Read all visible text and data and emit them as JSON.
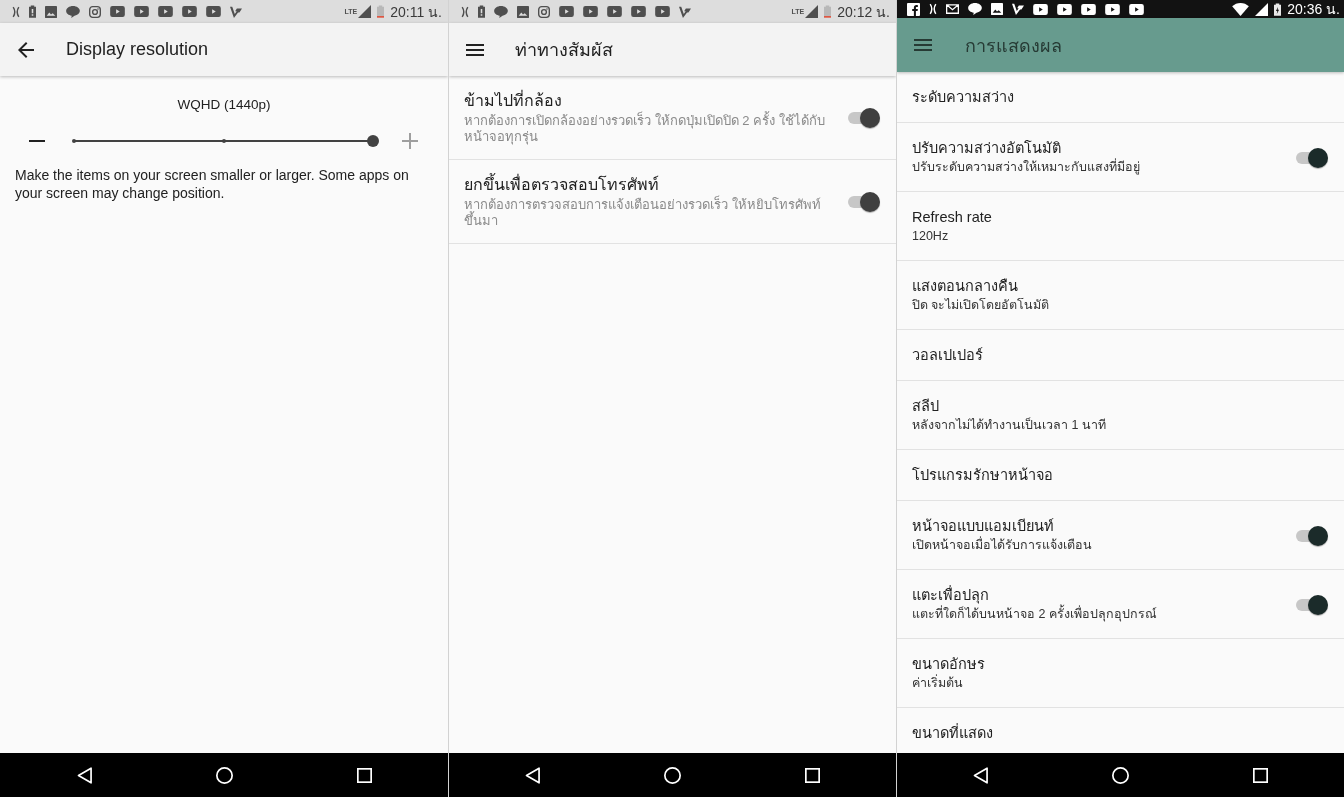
{
  "panels": [
    {
      "kind": "slider",
      "status_bar": {
        "network": "LTE",
        "time": "20:11 น."
      },
      "app_bar": {
        "kind": "back",
        "title": "Display resolution"
      },
      "resolution": {
        "label": "WQHD (1440p)",
        "level": 1
      },
      "description": "Make the items on your screen smaller or larger. Some apps on your screen may change position."
    },
    {
      "kind": "list",
      "status_bar": {
        "network": "LTE",
        "time": "20:12 น."
      },
      "app_bar": {
        "kind": "menu",
        "title": "ท่าทางสัมผัส"
      },
      "settings": [
        {
          "kind": "toggle",
          "title": "ข้ามไปที่กล้อง",
          "summary": "หากต้องการเปิดกล้องอย่างรวดเร็ว ให้กดปุ่มเปิดปิด 2 ครั้ง ใช้ได้กับหน้าจอทุกรุ่น",
          "on": true
        },
        {
          "kind": "toggle",
          "title": "ยกขึ้นเพื่อตรวจสอบโทรศัพท์",
          "summary": "หากต้องการตรวจสอบการแจ้งเตือนอย่างรวดเร็ว ให้หยิบโทรศัพท์ขึ้นมา",
          "on": true
        }
      ]
    },
    {
      "kind": "list",
      "status_bar": {
        "time": "20:36 น."
      },
      "app_bar": {
        "kind": "menu",
        "title": "การแสดงผล"
      },
      "settings": [
        {
          "kind": "text",
          "title": "ระดับความสว่าง"
        },
        {
          "kind": "toggle",
          "title": "ปรับความสว่างอัตโนมัติ",
          "summary": "ปรับระดับความสว่างให้เหมาะกับแสงที่มีอยู่",
          "on": true
        },
        {
          "kind": "text",
          "title": "Refresh rate",
          "summary": "120Hz"
        },
        {
          "kind": "text",
          "title": "แสงตอนกลางคืน",
          "summary": "ปิด จะไม่เปิดโดยอัตโนมัติ"
        },
        {
          "kind": "text",
          "title": "วอลเปเปอร์"
        },
        {
          "kind": "text",
          "title": "สลีป",
          "summary": "หลังจากไม่ได้ทำงานเป็นเวลา 1 นาที"
        },
        {
          "kind": "text",
          "title": "โปรแกรมรักษาหน้าจอ"
        },
        {
          "kind": "toggle",
          "title": "หน้าจอแบบแอมเบียนท์",
          "summary": "เปิดหน้าจอเมื่อได้รับการแจ้งเตือน",
          "on": true
        },
        {
          "kind": "toggle",
          "title": "แตะเพื่อปลุก",
          "summary": "แตะที่ใดก็ได้บนหน้าจอ 2 ครั้งเพื่อปลุกอุปกรณ์",
          "on": true
        },
        {
          "kind": "text",
          "title": "ขนาดอักษร",
          "summary": "ค่าเริ่มต้น"
        },
        {
          "kind": "text",
          "title": "ขนาดที่แสดง"
        }
      ]
    }
  ]
}
